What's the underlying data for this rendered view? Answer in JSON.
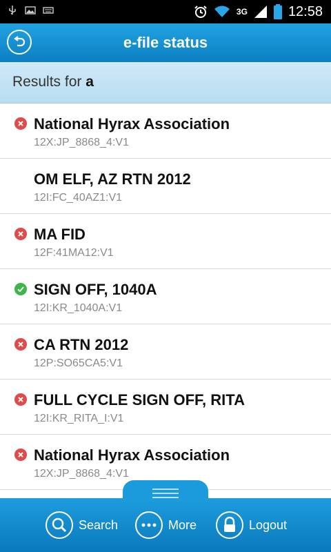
{
  "status_bar": {
    "time": "12:58",
    "network": "3G",
    "left_icons": [
      "usb-icon",
      "image-icon",
      "keyboard-icon"
    ],
    "right_icons": [
      "alarm-icon",
      "wifi-icon",
      "signal-icon",
      "battery-icon"
    ]
  },
  "header": {
    "title": "e-file status",
    "back_icon": "back-icon"
  },
  "results": {
    "prefix": "Results for",
    "query": "a"
  },
  "items": [
    {
      "status": "error",
      "title": "National Hyrax Association",
      "code": "12X:JP_8868_4:V1"
    },
    {
      "status": "none",
      "title": "OM ELF, AZ RTN 2012",
      "code": "12I:FC_40AZ1:V1"
    },
    {
      "status": "error",
      "title": "MA FID",
      "code": "12F:41MA12:V1"
    },
    {
      "status": "ok",
      "title": "SIGN OFF, 1040A",
      "code": "12I:KR_1040A:V1"
    },
    {
      "status": "error",
      "title": "CA RTN 2012",
      "code": "12P:SO65CA5:V1"
    },
    {
      "status": "error",
      "title": "FULL CYCLE SIGN OFF, RITA",
      "code": "12I:KR_RITA_I:V1"
    },
    {
      "status": "error",
      "title": "National Hyrax Association",
      "code": "12X:JP_8868_4:V1"
    }
  ],
  "colors": {
    "accent": "#1592d4",
    "error": "#e24a4a",
    "ok": "#3cb54a"
  },
  "bottom_bar": {
    "search_label": "Search",
    "more_label": "More",
    "logout_label": "Logout"
  }
}
